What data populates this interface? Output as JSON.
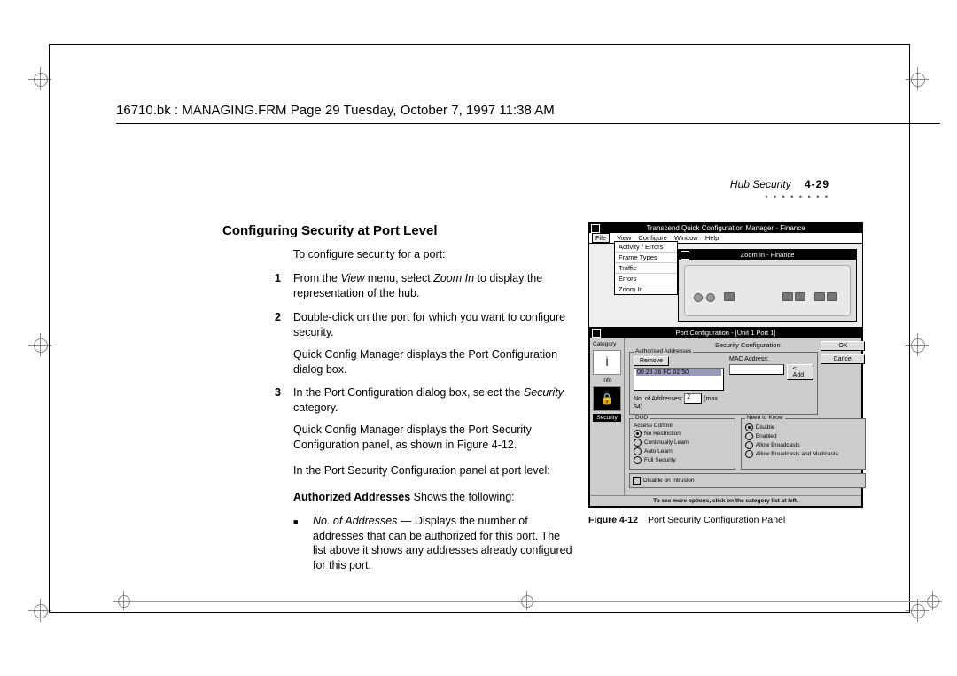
{
  "header_line": "16710.bk : MANAGING.FRM  Page 29  Tuesday, October 7, 1997  11:38 AM",
  "running_head": {
    "section": "Hub Security",
    "page": "4-29"
  },
  "heading": "Configuring Security at Port Level",
  "intro": "To configure security for a port:",
  "steps": [
    {
      "n": "1",
      "text_pre": "From the ",
      "em1": "View",
      "mid": " menu, select ",
      "em2": "Zoom In",
      "text_post": " to display the representation of the hub."
    },
    {
      "n": "2",
      "text": "Double-click on the port for which you want to configure security.",
      "follow": "Quick Config Manager displays the Port Configuration dialog box."
    },
    {
      "n": "3",
      "text_pre": "In the Port Configuration dialog box, select the ",
      "em1": "Security",
      "text_post": " category.",
      "follow": "Quick Config Manager displays the Port Security Configuration panel, as shown in Figure 4-12."
    }
  ],
  "para_after": "In the Port Security Configuration panel at port level:",
  "auth_line_strong": "Authorized Addresses",
  "auth_line_rest": " Shows the following:",
  "bullet_em": "No. of Addresses",
  "bullet_rest": " — Displays the number of addresses that can be authorized for this port. The list above it shows any addresses already configured for this port.",
  "figure": {
    "caption_num": "Figure 4-12",
    "caption_text": "Port Security Configuration Panel",
    "app_title": "Transcend Quick Configuration Manager - Finance",
    "menu": [
      "File",
      "View",
      "Configure",
      "Window",
      "Help"
    ],
    "flyout": [
      "Activity / Errors",
      "Frame Types",
      "Traffic",
      "Errors",
      "Zoom In"
    ],
    "zoom_title": "Zoom In - Finance",
    "portcfg_title": "Port Configuration - [Unit 1 Port 1]",
    "sec_subtitle": "Security Configuration",
    "cat_label": "Category",
    "cat_info": "Info",
    "cat_sec": "Security",
    "group_auth": "Authorised Addresses",
    "btn_remove": "Remove",
    "mac_label": "MAC Address:",
    "mac_value": "00 26 36 FC 02 50",
    "btn_add": "< Add",
    "noaddr_label": "No. of Addresses:",
    "noaddr_val": "2",
    "noaddr_max": "(max 34)",
    "btn_ok": "OK",
    "btn_cancel": "Cancel",
    "group_dud": "DUD",
    "dud_ac": "Access Control",
    "dud_opts": [
      "No Restriction",
      "Continually Learn",
      "Auto Learn",
      "Full Security"
    ],
    "dud_checked": 0,
    "ntk_title": "Need to Know",
    "ntk_opts": [
      "Disable",
      "Enabled",
      "Allow Broadcasts",
      "Allow Broadcasts and Multicasts"
    ],
    "ntk_checked": 0,
    "chk_disable": "Disable on Intrusion",
    "footer": "To see more options, click on the category list at left."
  }
}
